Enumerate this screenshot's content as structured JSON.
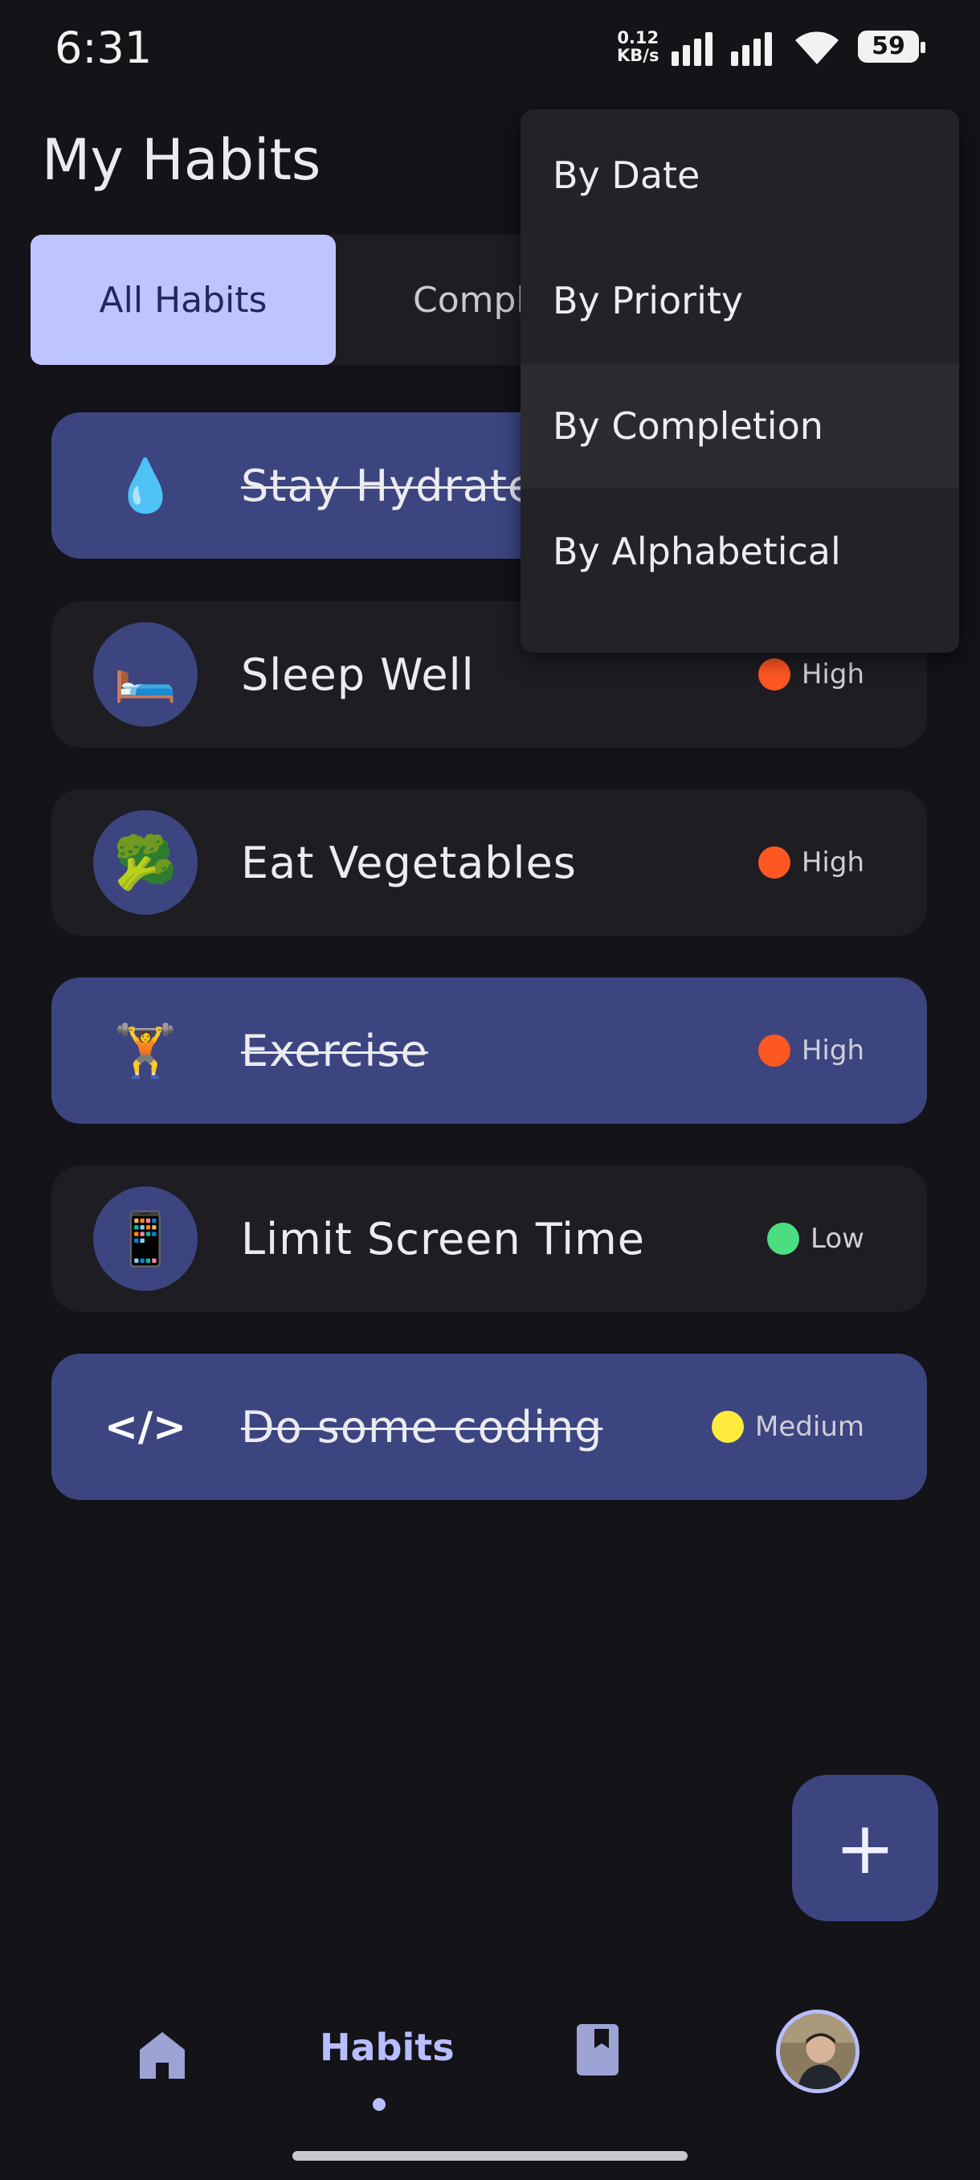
{
  "status_bar": {
    "time": "6:31",
    "net_speed_value": "0.12",
    "net_speed_unit": "KB/s",
    "battery": "59"
  },
  "header": {
    "title": "My Habits"
  },
  "tabs": [
    {
      "label": "All Habits",
      "selected": true
    },
    {
      "label": "Comple",
      "selected": false
    }
  ],
  "habits": [
    {
      "name": "Stay Hydrate",
      "icon": "💧",
      "completed": true,
      "priority": "",
      "priority_color": ""
    },
    {
      "name": "Sleep Well",
      "icon": "🛏️",
      "completed": false,
      "priority": "High",
      "priority_color": "#ff5722"
    },
    {
      "name": "Eat Vegetables",
      "icon": "🥦",
      "completed": false,
      "priority": "High",
      "priority_color": "#ff5722"
    },
    {
      "name": "Exercise",
      "icon": "🏋️",
      "completed": true,
      "priority": "High",
      "priority_color": "#ff5722"
    },
    {
      "name": "Limit Screen Time",
      "icon": "📱",
      "completed": false,
      "priority": "Low",
      "priority_color": "#4ade80"
    },
    {
      "name": "Do some coding",
      "icon": "</>",
      "completed": true,
      "priority": "Medium",
      "priority_color": "#ffeb3b"
    }
  ],
  "sort_menu": {
    "items": [
      "By Date",
      "By Priority",
      "By Completion",
      "By Alphabetical"
    ],
    "highlighted": "By Completion"
  },
  "fab": {
    "label": "+"
  },
  "bottom_nav": {
    "items": [
      {
        "icon": "home-icon",
        "label": ""
      },
      {
        "icon": "",
        "label": "Habits",
        "active": true
      },
      {
        "icon": "book-icon",
        "label": ""
      },
      {
        "icon": "profile-avatar",
        "label": ""
      }
    ]
  },
  "colors": {
    "background": "#131318",
    "accent": "#bec4ff",
    "completed_card": "#3c4580",
    "card": "#1d1d22"
  }
}
